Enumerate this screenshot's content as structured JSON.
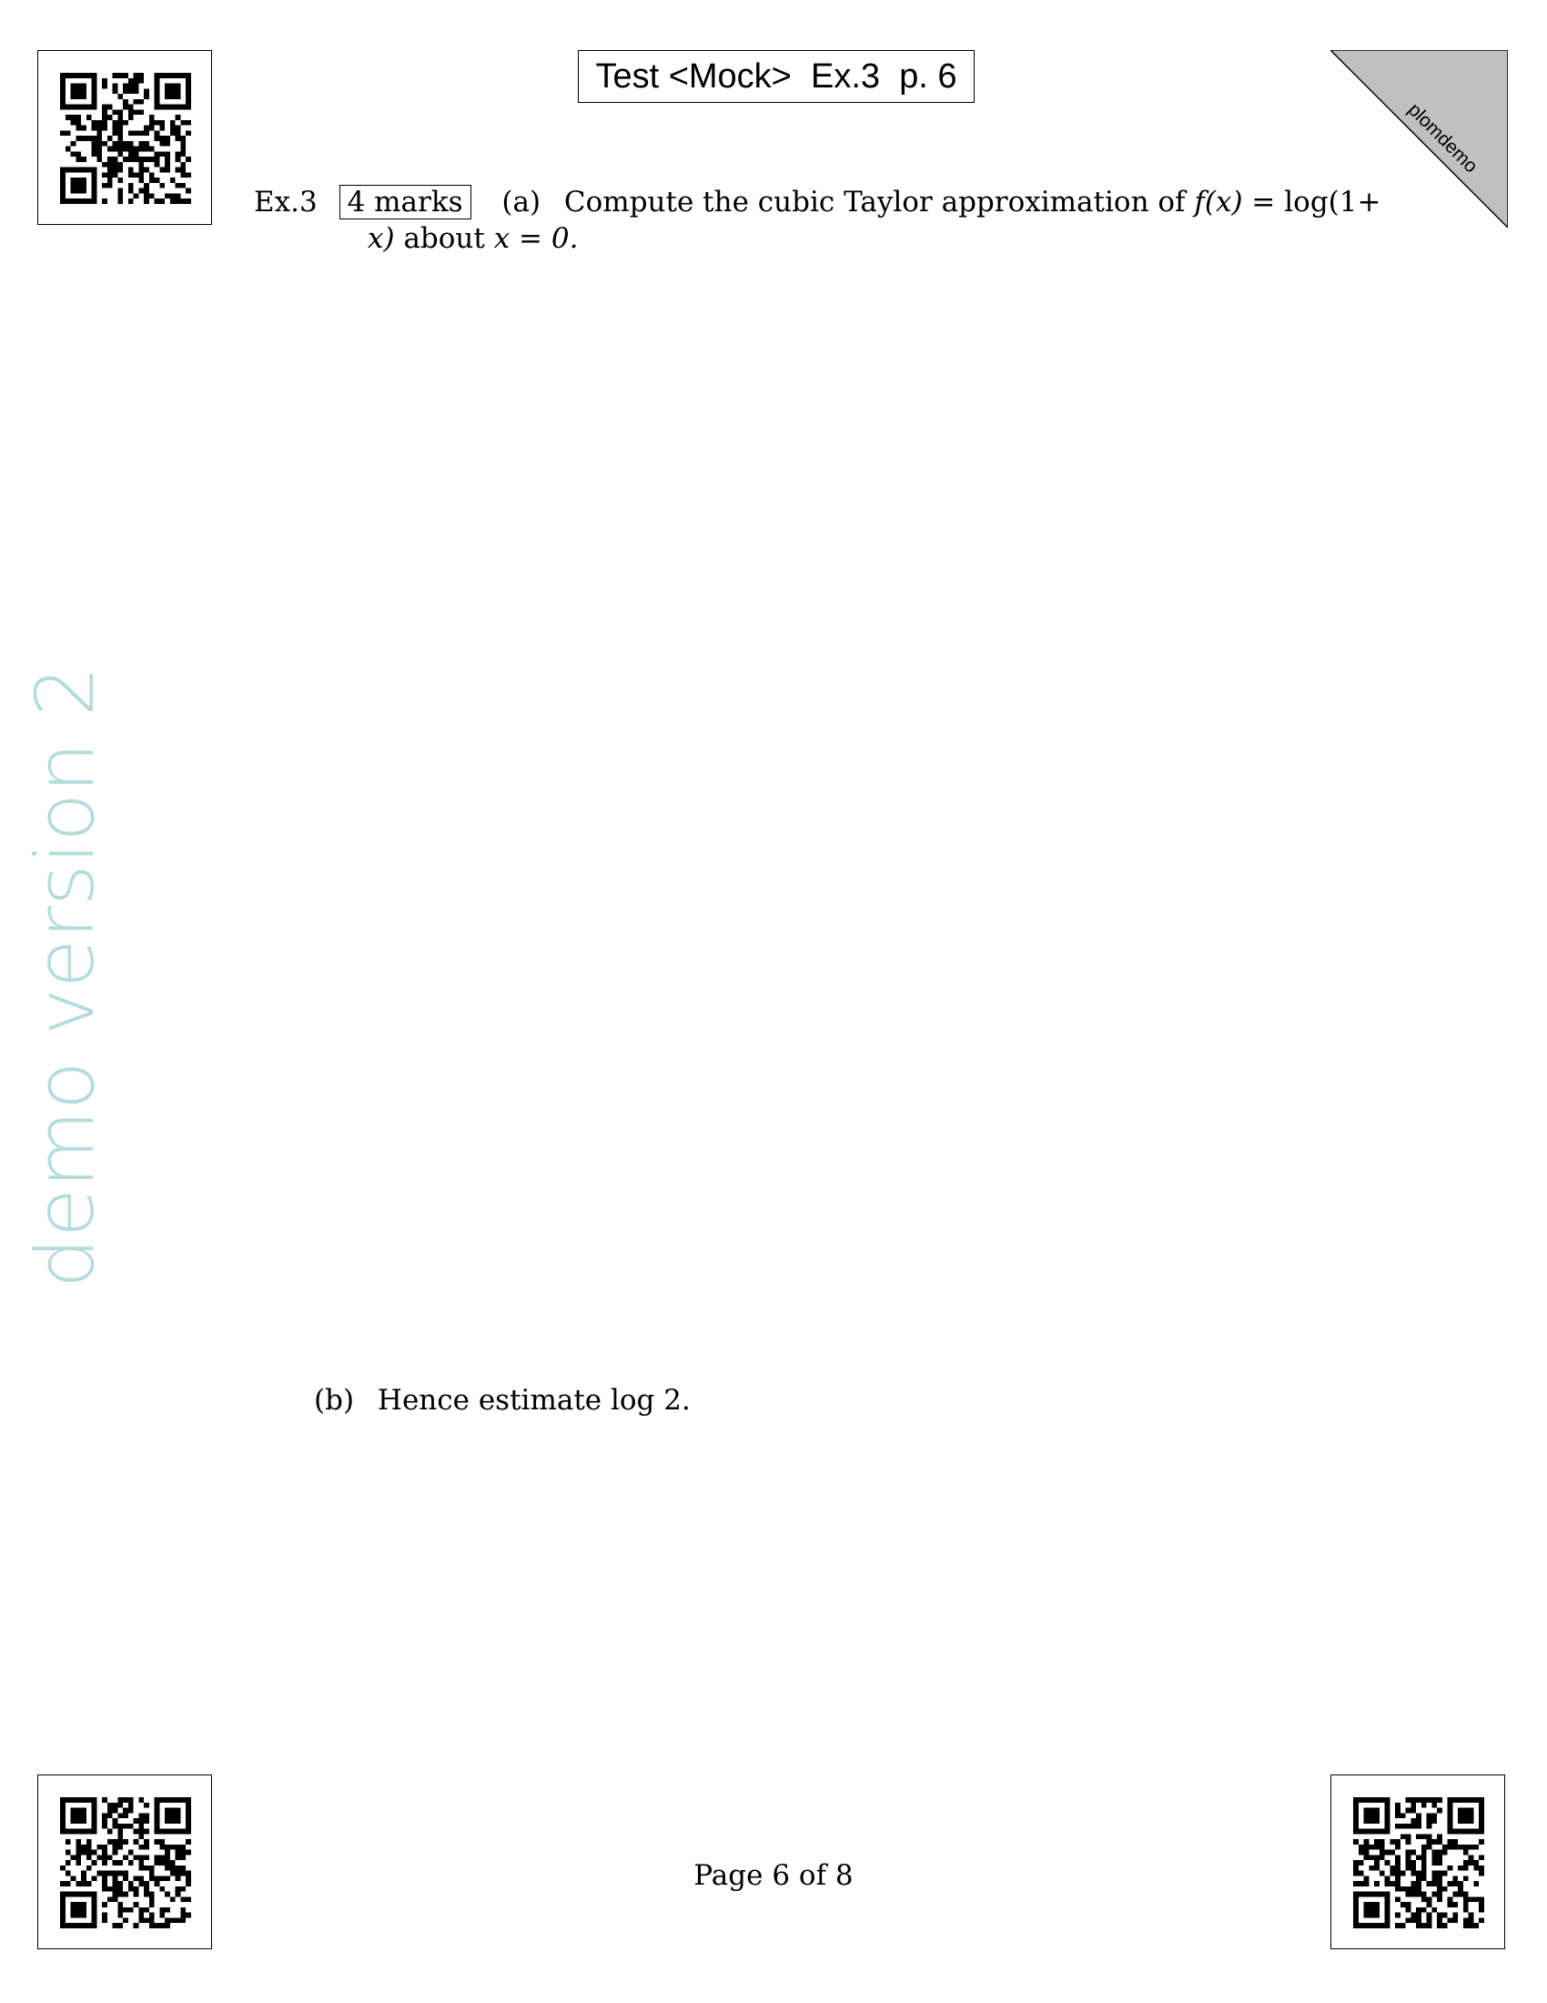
{
  "header": {
    "title": "Test <Mock>  Ex.3  p. 6"
  },
  "corner": {
    "label": "plomdemo"
  },
  "watermark": {
    "text": "demo version 2"
  },
  "question": {
    "number": "Ex.3",
    "marks": "4 marks",
    "part_a": {
      "label": "(a)",
      "text_1": "Compute the cubic Taylor approximation of",
      "f_x": "f(x)",
      "eq": "=",
      "log_open": "log(1+",
      "x_close": "x)",
      "text_2": "about",
      "x_eq_0": "x = 0."
    },
    "part_b": {
      "label": "(b)",
      "text": "Hence estimate log 2."
    }
  },
  "footer": {
    "page": "Page 6 of 8"
  },
  "colors": {
    "watermark": "#b5dcdc",
    "corner_fill": "#c0c0c0"
  },
  "qr_codes": [
    "qr-code-top-left",
    "qr-code-bottom-left",
    "qr-code-bottom-right"
  ]
}
